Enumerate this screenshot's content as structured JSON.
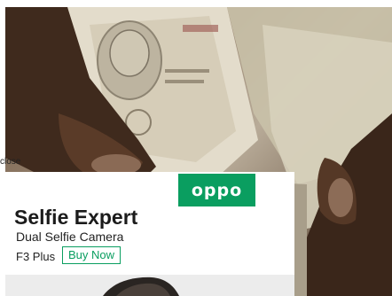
{
  "overlay": {
    "close_label": "close"
  },
  "ad": {
    "logo_text": "oppo",
    "headline": "Selfie Expert",
    "subheadline": "Dual Selfie Camera",
    "model": "F3 Plus",
    "cta_label": "Buy Now",
    "brand_color": "#0a9e60"
  },
  "photo": {
    "subject": "hands-holding-banknotes"
  }
}
